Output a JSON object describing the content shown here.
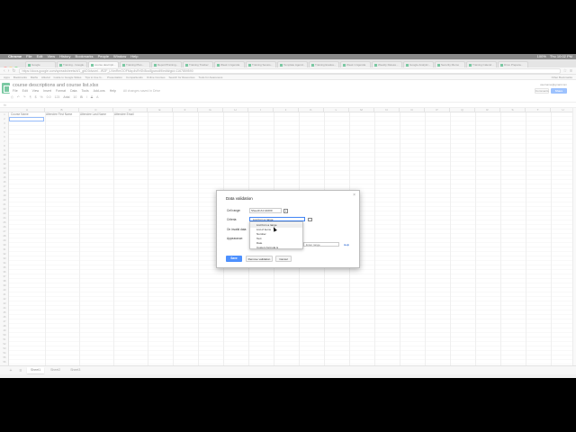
{
  "menubar": {
    "app": "Chrome",
    "items": [
      "File",
      "Edit",
      "View",
      "History",
      "Bookmarks",
      "People",
      "Window",
      "Help"
    ],
    "right": [
      "100%",
      "Thu 10:02 PM"
    ]
  },
  "tabs": [
    {
      "label": "Google"
    },
    {
      "label": "Training - Google..."
    },
    {
      "label": "course descripti...",
      "active": true
    },
    {
      "label": "Training Plan..."
    },
    {
      "label": "Report/Training..."
    },
    {
      "label": "Training Tracker"
    },
    {
      "label": "Week 1 Agenda"
    },
    {
      "label": "Training Sessio..."
    },
    {
      "label": "Template Agend..."
    },
    {
      "label": "Training Evalua..."
    },
    {
      "label": "Week 1 Agenda"
    },
    {
      "label": "Weekly Releas..."
    },
    {
      "label": "Google Analytic..."
    },
    {
      "label": "Security Memo"
    },
    {
      "label": "Training Calend..."
    },
    {
      "label": "Drive Prepara..."
    }
  ],
  "address_bar": {
    "url": "https://docs.google.com/spreadsheets/d/1_gbD0dvuml...iRZF_LNmRmOOFMzp4vRrSN5oc5jpwodi9/edit#gid=1167859590"
  },
  "bookmarks": {
    "items": [
      "Apps",
      "Bookmarks",
      "Maths",
      "Alluvial",
      "Guide to Google Slides",
      "Tips to Use G...",
      "Presentation",
      "Compartiendo",
      "Online Courses",
      "Search for Resources",
      "Tools for Awareness"
    ],
    "other": "Other Bookmarks"
  },
  "doc": {
    "title": "course descriptions and course list.xlsx",
    "menus": [
      "File",
      "Edit",
      "View",
      "Insert",
      "Format",
      "Data",
      "Tools",
      "Add-ons",
      "Help"
    ],
    "saved_status": "All changes saved in Drive",
    "user_email": "username@gmail.com",
    "comments_label": "Comments",
    "share_label": "Share"
  },
  "toolbar": {
    "items": [
      "⎙",
      "↶",
      "↷",
      "¶",
      "$",
      "%",
      "0.0",
      "123"
    ],
    "font": "Arial",
    "font_size": "10",
    "format_buttons": [
      "B",
      "I",
      "S",
      "A"
    ]
  },
  "formula_bar": {
    "fx": "fx",
    "value": ""
  },
  "sheet": {
    "columns": [
      "A",
      "B",
      "C",
      "D",
      "E",
      "F",
      "G",
      "H",
      "I",
      "J",
      "K",
      "L",
      "M",
      "N",
      "O",
      "P",
      "Q",
      "R",
      "S",
      "T",
      "U",
      "V"
    ],
    "headers": [
      "Course Name",
      "Attendee First Name",
      "Attendee Last Name",
      "Attendee Email"
    ],
    "row_count": 56
  },
  "sheet_tabs": {
    "add": "+",
    "list": "≡",
    "tabs": [
      {
        "label": "Sheet1",
        "active": true
      },
      {
        "label": "Sheet2"
      },
      {
        "label": "Sheet3"
      }
    ]
  },
  "dialog": {
    "title": "Data validation",
    "close": "×",
    "cell_range_label": "Cell range:",
    "cell_range_value": "Sheet1!A1:A1000",
    "criteria_label": "Criteria:",
    "criteria_value": "List from a range",
    "invalid_label": "On invalid data:",
    "appearance_label": "Appearance:",
    "appearance_placeholder": "Enter range",
    "help_link": "Help",
    "options": [
      "List from a range",
      "List of items",
      "Number",
      "Text",
      "Date",
      "Custom formula is"
    ],
    "highlighted_option": 0,
    "save_label": "Save",
    "remove_label": "Remove validation",
    "cancel_label": "Cancel"
  }
}
